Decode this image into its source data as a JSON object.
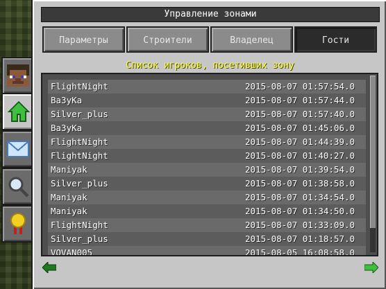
{
  "window": {
    "title": "Управление зонами"
  },
  "tabs": [
    {
      "label": "Параметры",
      "active": false
    },
    {
      "label": "Строители",
      "active": false
    },
    {
      "label": "Владелец",
      "active": false
    },
    {
      "label": "Гости",
      "active": true
    }
  ],
  "list": {
    "heading": "Список игроков, посетивших зону",
    "rows": [
      {
        "name": "FlightNight",
        "date": "2015-08-07 01:57:54.0"
      },
      {
        "name": "Ba3yKa",
        "date": "2015-08-07 01:57:44.0"
      },
      {
        "name": "Silver_plus",
        "date": "2015-08-07 01:57:40.0"
      },
      {
        "name": "Ba3yKa",
        "date": "2015-08-07 01:45:06.0"
      },
      {
        "name": "FlightNight",
        "date": "2015-08-07 01:44:39.0"
      },
      {
        "name": "FlightNight",
        "date": "2015-08-07 01:40:27.0"
      },
      {
        "name": "Maniyak",
        "date": "2015-08-07 01:39:54.0"
      },
      {
        "name": "Silver_plus",
        "date": "2015-08-07 01:38:58.0"
      },
      {
        "name": "Maniyak",
        "date": "2015-08-07 01:34:54.0"
      },
      {
        "name": "Maniyak",
        "date": "2015-08-07 01:34:50.0"
      },
      {
        "name": "FlightNight",
        "date": "2015-08-07 01:33:09.0"
      },
      {
        "name": "Silver_plus",
        "date": "2015-08-07 01:18:57.0"
      },
      {
        "name": "VOVAN005",
        "date": "2015-08-05 16:08:58.0"
      }
    ]
  },
  "sidebar": [
    {
      "icon": "player-head-icon",
      "active": false
    },
    {
      "icon": "house-icon",
      "active": true
    },
    {
      "icon": "envelope-icon",
      "active": false
    },
    {
      "icon": "magnifier-icon",
      "active": false
    },
    {
      "icon": "medal-icon",
      "active": false
    }
  ],
  "colors": {
    "accent_yellow": "#ffff3a",
    "arrow_green": "#2a9a2a"
  }
}
